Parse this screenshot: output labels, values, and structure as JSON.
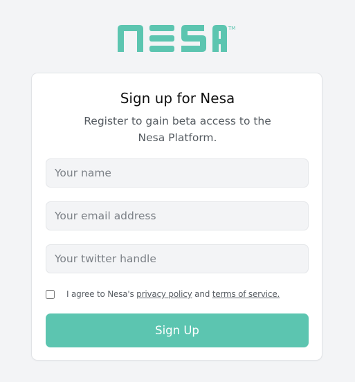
{
  "brand": {
    "name": "NESA",
    "trademark": "TM",
    "color": "#5cc5b0"
  },
  "form": {
    "title": "Sign up for Nesa",
    "subtitle": "Register to gain beta access to the Nesa Platform.",
    "name_placeholder": "Your name",
    "email_placeholder": "Your email address",
    "twitter_placeholder": "Your twitter handle",
    "agree_prefix": "I agree to Nesa's ",
    "privacy_link": "privacy policy",
    "agree_and": " and ",
    "terms_link": "terms of service.",
    "submit_label": "Sign Up",
    "agree_checked": false
  }
}
